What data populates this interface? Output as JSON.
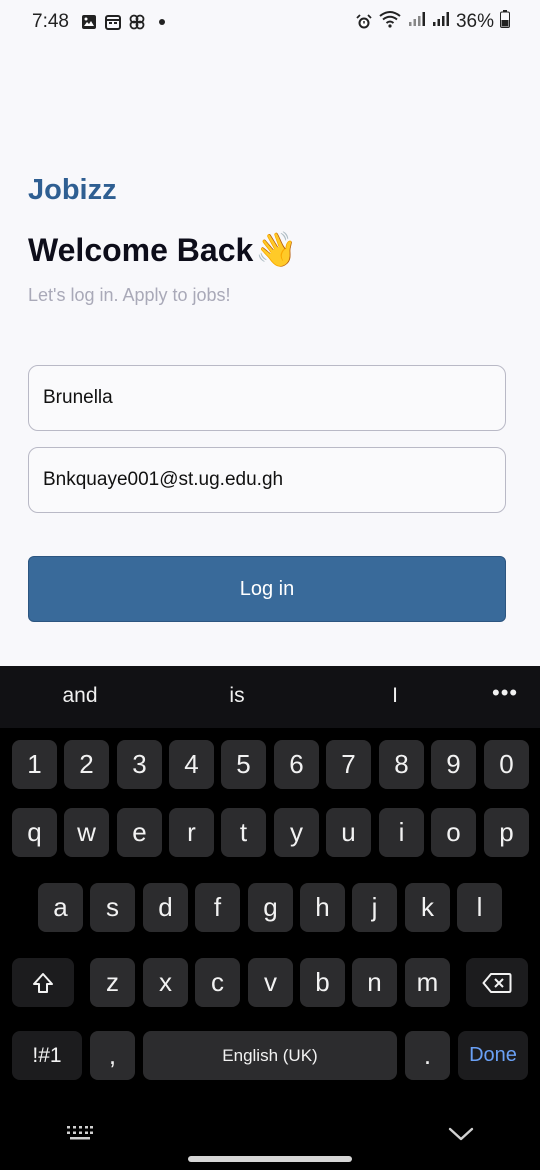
{
  "status_bar": {
    "time": "7:48",
    "battery": "36%",
    "icons": [
      "image-icon",
      "calendar-icon",
      "pinwheel-icon",
      "dot-icon",
      "alarm-icon",
      "wifi-icon",
      "signal-icon",
      "signal-icon-2",
      "battery-icon"
    ]
  },
  "app": {
    "brand": "Jobizz",
    "title": "Welcome Back",
    "title_emoji": "👋",
    "subtitle": "Let's log in. Apply to jobs!",
    "username_value": "Brunella",
    "email_value": "Bnkquaye001@st.ug.edu.gh",
    "login_label": "Log in",
    "brand_color": "#2f5f92",
    "button_color": "#396a9a"
  },
  "keyboard": {
    "suggestions": [
      "and",
      "is",
      "I"
    ],
    "more_label": "•••",
    "row_numbers": [
      "1",
      "2",
      "3",
      "4",
      "5",
      "6",
      "7",
      "8",
      "9",
      "0"
    ],
    "row_q": [
      "q",
      "w",
      "e",
      "r",
      "t",
      "y",
      "u",
      "i",
      "o",
      "p"
    ],
    "row_a": [
      "a",
      "s",
      "d",
      "f",
      "g",
      "h",
      "j",
      "k",
      "l"
    ],
    "row_z": [
      "z",
      "x",
      "c",
      "v",
      "b",
      "n",
      "m"
    ],
    "symbols_label": "!#1",
    "comma_label": ",",
    "space_label": "English (UK)",
    "period_label": ".",
    "done_label": "Done"
  }
}
